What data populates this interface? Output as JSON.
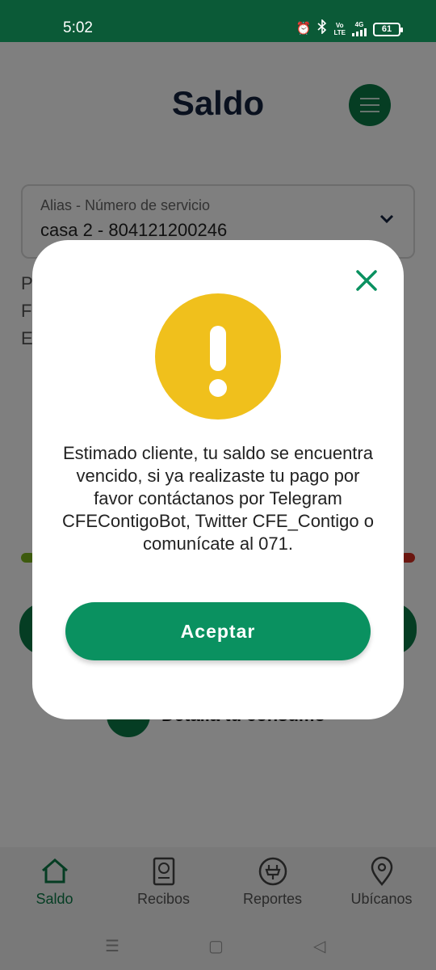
{
  "status_bar": {
    "time": "5:02",
    "battery": "61",
    "network_label_top": "Vo",
    "network_label_bottom": "LTE",
    "signal_label": "4G"
  },
  "header": {
    "title": "Saldo"
  },
  "service": {
    "label": "Alias - Número de servicio",
    "value": "casa 2 - 804121200246"
  },
  "side_letters": [
    "P",
    "F",
    "E"
  ],
  "consumo": {
    "label": "Detalla tu consumo"
  },
  "bottom_nav": {
    "items": [
      {
        "label": "Saldo",
        "icon": "home-icon"
      },
      {
        "label": "Recibos",
        "icon": "receipt-icon"
      },
      {
        "label": "Reportes",
        "icon": "plug-icon"
      },
      {
        "label": "Ubícanos",
        "icon": "location-pin-icon"
      }
    ]
  },
  "dialog": {
    "message": "Estimado cliente, tu saldo se encuentra vencido, si ya realizaste tu pago por favor contáctanos por Telegram CFEContigoBot, Twitter CFE_Contigo o comunícate al 071.",
    "accept_label": "Aceptar"
  },
  "colors": {
    "brand_green": "#0b7a47",
    "button_green": "#0a9160",
    "alert_yellow": "#f0c01c",
    "status_bar": "#0b5a37",
    "title_navy": "#14233f"
  }
}
